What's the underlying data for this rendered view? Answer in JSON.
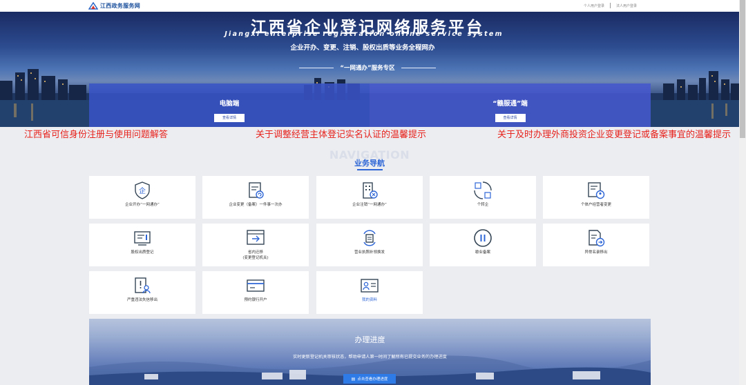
{
  "header": {
    "logo_text": "江西政务服务网",
    "link_personal": "个人用户登录",
    "link_legal": "法人用户登录"
  },
  "hero": {
    "title": "江西省企业登记网络服务平台",
    "subtitle_en": "Jiangxi enterprise registration online service system",
    "subtitle_cn": "企业开办、变更、注销、股权出质等业务全程网办",
    "zone_label": "“一网通办”服务专区",
    "panels": [
      {
        "title": "电脑端",
        "button": "查看详情"
      },
      {
        "title": "“赣服通”端",
        "button": "查看详情"
      }
    ]
  },
  "notices": [
    "江西省可信身份注册与使用问题解答",
    "关于调整经营主体登记实名认证的温馨提示",
    "关于及时办理外商投资企业变更登记或备案事宜的温馨提示"
  ],
  "navigation": {
    "bg_word": "NAVIGATION",
    "title": "业务导航",
    "cards": [
      {
        "icon": "enterprise-seal-icon",
        "label": "企业开办“一网通办”"
      },
      {
        "icon": "document-refresh-icon",
        "label": "企业变更（备案）一件事一次办"
      },
      {
        "icon": "building-cancel-icon",
        "label": "企业注销“一网通办”"
      },
      {
        "icon": "circle-transfer-icon",
        "label": "个转企"
      },
      {
        "icon": "user-document-icon",
        "label": "个体户经营者变更"
      },
      {
        "icon": "equity-pledge-icon",
        "label": "股权出质登记"
      },
      {
        "icon": "window-arrow-icon",
        "label": "省内迁移",
        "label2": "(变更登记机关)"
      },
      {
        "icon": "license-reissue-icon",
        "label": "营业执照补领换发"
      },
      {
        "icon": "pause-icon",
        "label": "歇业备案"
      },
      {
        "icon": "document-arrow-icon",
        "label": "异常名录移出"
      },
      {
        "icon": "warning-user-icon",
        "label": "严重违法失信移出"
      },
      {
        "icon": "bank-card-icon",
        "label": "预约银行开户"
      },
      {
        "icon": "id-card-icon",
        "label": "我的资料",
        "highlight": true
      }
    ]
  },
  "progress": {
    "title": "办理进度",
    "description": "实时更新登记机关审核状态，帮助申请人第一时间了解所有已提交业务的办理进度",
    "button": "点击查看办理进度"
  }
}
